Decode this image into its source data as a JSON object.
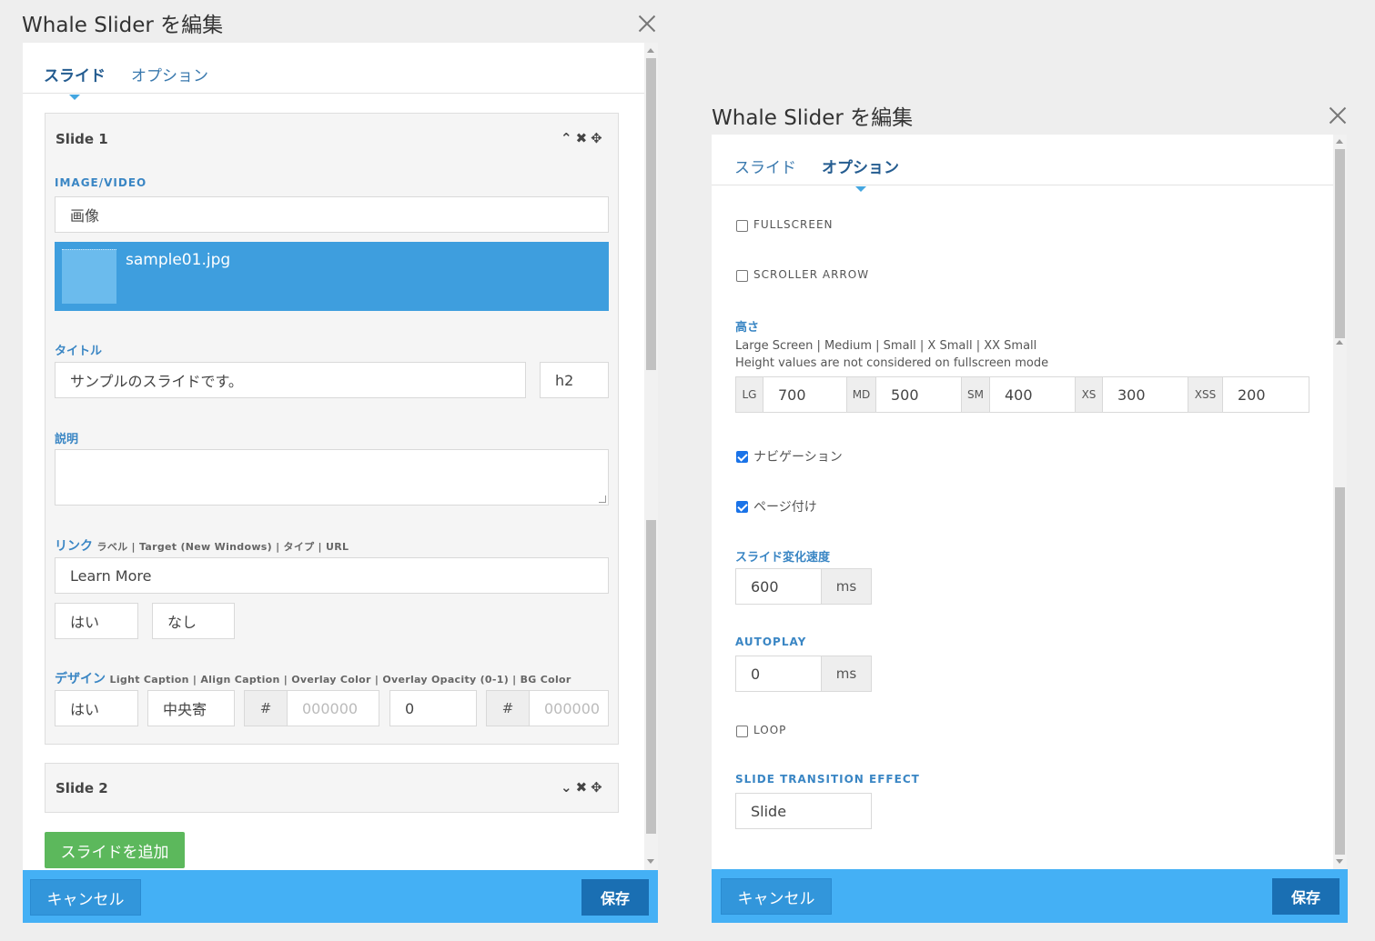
{
  "left_dialog": {
    "title": "Whale Slider を編集",
    "tabs": [
      {
        "label": "スライド",
        "active": true
      },
      {
        "label": "オプション",
        "active": false
      }
    ],
    "slides": [
      {
        "name": "Slide 1",
        "expanded": true,
        "image_video_label": "IMAGE/VIDEO",
        "media_type": "画像",
        "image_file": "sample01.jpg",
        "title_label": "タイトル",
        "title_value": "サンプルのスライドです。",
        "heading_level": "h2",
        "description_label": "説明",
        "description_value": "",
        "link_label": "リンク",
        "link_sub": "ラベル | Target (New Windows) | タイプ | URL",
        "link_label_value": "Learn More",
        "link_target": "はい",
        "link_type": "なし",
        "design_label": "デザイン",
        "design_sub": "Light Caption | Align Caption | Overlay Color | Overlay Opacity (0-1) | BG Color",
        "light_caption": "はい",
        "align_caption": "中央寄",
        "hash": "#",
        "overlay_color_placeholder": "000000",
        "overlay_opacity": "0",
        "bg_color_placeholder": "000000"
      },
      {
        "name": "Slide 2",
        "expanded": false
      }
    ],
    "slide_controls_expanded": {
      "collapse": "⌃",
      "remove": "✖",
      "move": "✥"
    },
    "slide_controls_collapsed": {
      "expand": "⌄",
      "remove": "✖",
      "move": "✥"
    },
    "add_slide": "スライドを追加",
    "cancel": "キャンセル",
    "save": "保存"
  },
  "right_dialog": {
    "title": "Whale Slider を編集",
    "tabs": [
      {
        "label": "スライド",
        "active": false
      },
      {
        "label": "オプション",
        "active": true
      }
    ],
    "fullscreen": {
      "label": "FULLSCREEN",
      "checked": false
    },
    "scroller_arrow": {
      "label": "SCROLLER ARROW",
      "checked": false
    },
    "height": {
      "label": "高さ",
      "help1": "Large Screen | Medium | Small | X Small | XX Small",
      "help2": "Height values are not considered on fullscreen mode",
      "values": [
        {
          "addon": "LG",
          "value": "700"
        },
        {
          "addon": "MD",
          "value": "500"
        },
        {
          "addon": "SM",
          "value": "400"
        },
        {
          "addon": "XS",
          "value": "300"
        },
        {
          "addon": "XSS",
          "value": "200"
        }
      ]
    },
    "navigation": {
      "label": "ナビゲーション",
      "checked": true
    },
    "pagination": {
      "label": "ページ付け",
      "checked": true
    },
    "speed": {
      "label": "スライド変化速度",
      "value": "600",
      "unit": "ms"
    },
    "autoplay": {
      "label": "AUTOPLAY",
      "value": "0",
      "unit": "ms"
    },
    "loop": {
      "label": "LOOP",
      "checked": false
    },
    "transition": {
      "label": "SLIDE TRANSITION EFFECT",
      "value": "Slide"
    },
    "cancel": "キャンセル",
    "save": "保存"
  },
  "colors": {
    "accent": "#3a86c4",
    "footer": "#44b0f5",
    "save_button": "#1a6fb3",
    "add_button": "#5cb85c",
    "image_card": "#3e9ede"
  }
}
